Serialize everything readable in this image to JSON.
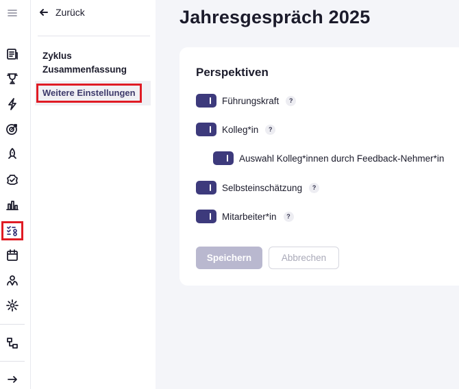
{
  "rail": {
    "items": [
      "menu-icon",
      "reports-icon",
      "trophy-icon",
      "bolt-icon",
      "target-icon",
      "rocket-icon",
      "badge-check-icon",
      "chart-icon",
      "review-checklist-icon",
      "calendar-icon",
      "people-icon",
      "gear-icon",
      "org-chart-icon",
      "expand-arrow-icon"
    ],
    "highlight_color": "#e01b24"
  },
  "subnav": {
    "back_label": "Zurück",
    "cycle_label": "Zyklus Zusammenfassung",
    "settings_label": "Weitere Einstellungen"
  },
  "page": {
    "title": "Jahresgespräch 2025"
  },
  "perspectives": {
    "title": "Perspektiven",
    "items": [
      {
        "label": "Führungskraft",
        "enabled": true,
        "help": "?"
      },
      {
        "label": "Kolleg*in",
        "enabled": true,
        "help": "?"
      },
      {
        "label": "Auswahl Kolleg*innen durch Feedback-Nehmer*in",
        "enabled": true
      },
      {
        "label": "Selbsteinschätzung",
        "enabled": true,
        "help": "?"
      },
      {
        "label": "Mitarbeiter*in",
        "enabled": true,
        "help": "?"
      }
    ]
  },
  "actions": {
    "save_label": "Speichern",
    "cancel_label": "Abbrechen"
  },
  "colors": {
    "accent": "#3d3a7c",
    "save_disabled": "#b9b8cf"
  }
}
